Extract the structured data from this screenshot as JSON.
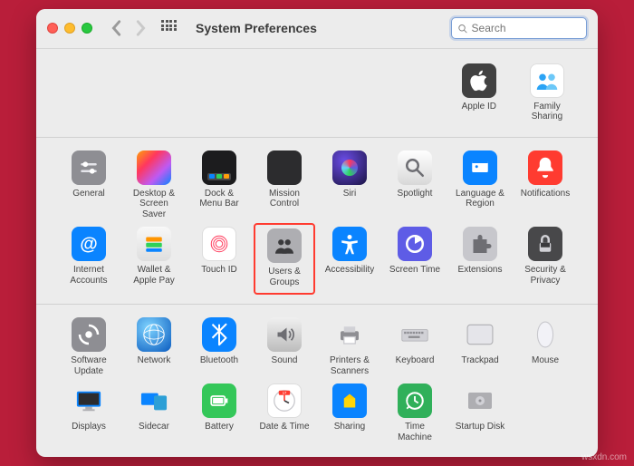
{
  "titlebar": {
    "title": "System Preferences",
    "search_placeholder": "Search"
  },
  "top_row": [
    {
      "id": "apple-id",
      "label": "Apple ID"
    },
    {
      "id": "family-sharing",
      "label": "Family Sharing"
    }
  ],
  "grid1": [
    {
      "id": "general",
      "label": "General"
    },
    {
      "id": "desktop-screensaver",
      "label": "Desktop & Screen Saver"
    },
    {
      "id": "dock-menubar",
      "label": "Dock & Menu Bar"
    },
    {
      "id": "mission-control",
      "label": "Mission Control"
    },
    {
      "id": "siri",
      "label": "Siri"
    },
    {
      "id": "spotlight",
      "label": "Spotlight"
    },
    {
      "id": "language-region",
      "label": "Language & Region"
    },
    {
      "id": "notifications",
      "label": "Notifications"
    },
    {
      "id": "internet-accounts",
      "label": "Internet Accounts"
    },
    {
      "id": "wallet-applepay",
      "label": "Wallet & Apple Pay"
    },
    {
      "id": "touch-id",
      "label": "Touch ID"
    },
    {
      "id": "users-groups",
      "label": "Users & Groups",
      "highlighted": true
    },
    {
      "id": "accessibility",
      "label": "Accessibility"
    },
    {
      "id": "screen-time",
      "label": "Screen Time"
    },
    {
      "id": "extensions",
      "label": "Extensions"
    },
    {
      "id": "security-privacy",
      "label": "Security & Privacy"
    }
  ],
  "grid2": [
    {
      "id": "software-update",
      "label": "Software Update"
    },
    {
      "id": "network",
      "label": "Network"
    },
    {
      "id": "bluetooth",
      "label": "Bluetooth"
    },
    {
      "id": "sound",
      "label": "Sound"
    },
    {
      "id": "printers-scanners",
      "label": "Printers & Scanners"
    },
    {
      "id": "keyboard",
      "label": "Keyboard"
    },
    {
      "id": "trackpad",
      "label": "Trackpad"
    },
    {
      "id": "mouse",
      "label": "Mouse"
    },
    {
      "id": "displays",
      "label": "Displays"
    },
    {
      "id": "sidecar",
      "label": "Sidecar"
    },
    {
      "id": "battery",
      "label": "Battery"
    },
    {
      "id": "date-time",
      "label": "Date & Time"
    },
    {
      "id": "sharing",
      "label": "Sharing"
    },
    {
      "id": "time-machine",
      "label": "Time Machine"
    },
    {
      "id": "startup-disk",
      "label": "Startup Disk"
    }
  ],
  "watermark": "wsxdn.com"
}
